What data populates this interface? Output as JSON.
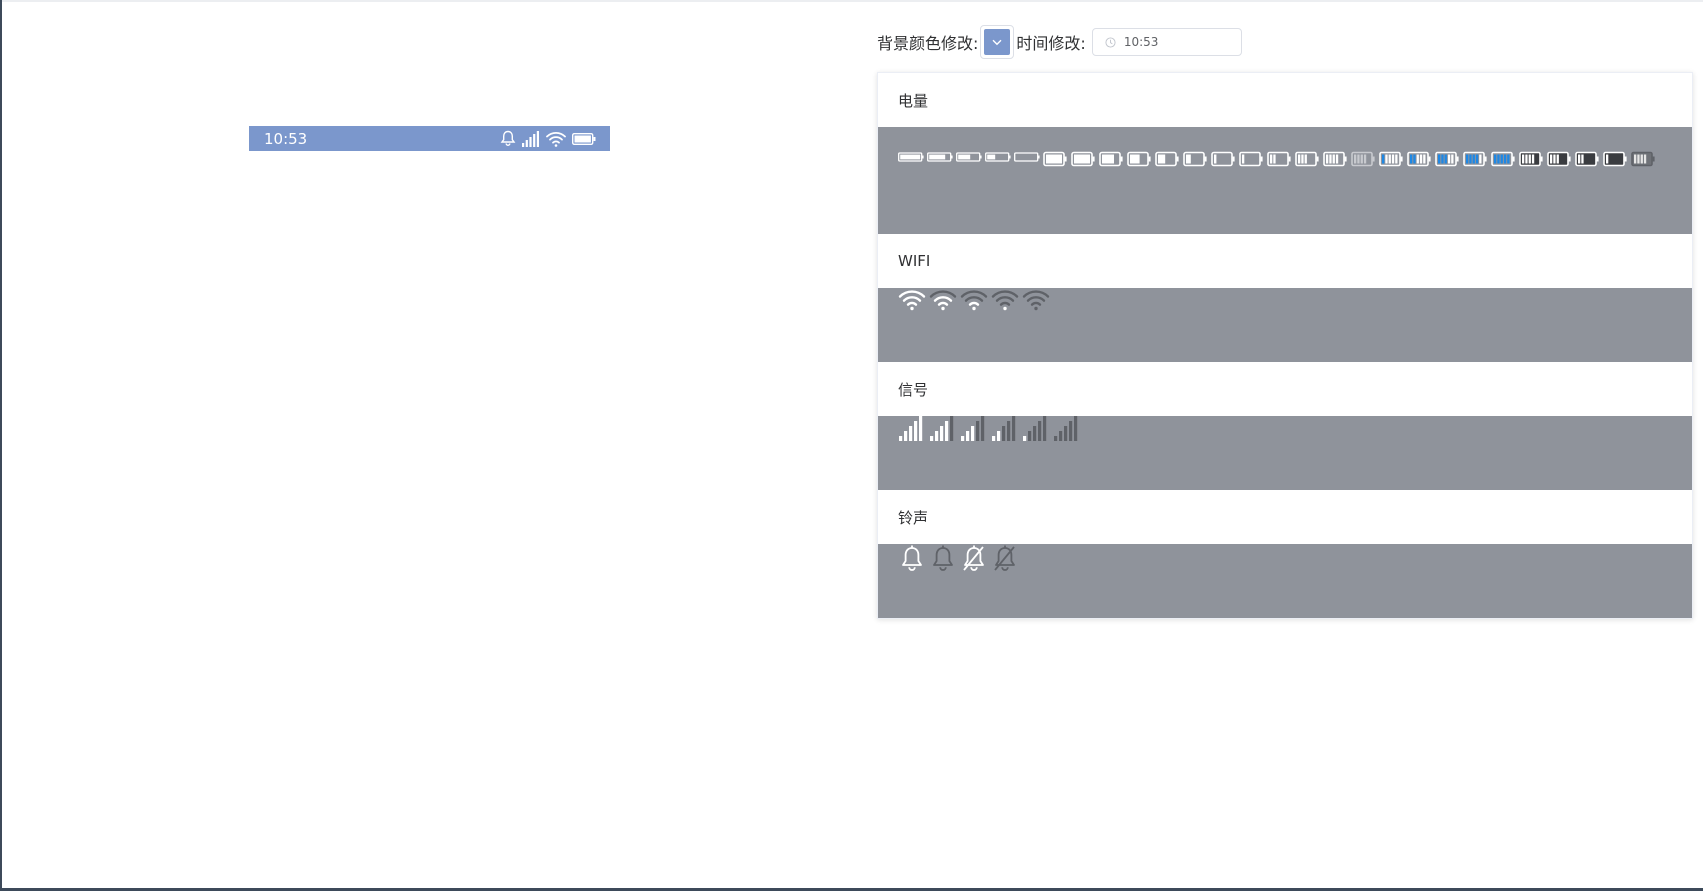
{
  "status_bar": {
    "time": "10:53",
    "background": "#7b97cc",
    "icons": [
      "bell-icon",
      "signal-icon",
      "wifi-icon",
      "battery-icon"
    ]
  },
  "toolbar": {
    "bg_color_label": "背景颜色修改:",
    "bg_color_value": "#7b97cc",
    "time_label": "时间修改:",
    "time_value": "10:53"
  },
  "sections": {
    "battery": {
      "title": "电量",
      "icons": [
        {
          "name": "battery-long-icon",
          "fill": 1.0,
          "color": "#ffffff",
          "long": true
        },
        {
          "name": "battery-long-icon",
          "fill": 0.8,
          "color": "#ffffff",
          "long": true
        },
        {
          "name": "battery-long-icon",
          "fill": 0.6,
          "color": "#ffffff",
          "long": true
        },
        {
          "name": "battery-long-icon",
          "fill": 0.4,
          "color": "#ffffff",
          "long": true
        },
        {
          "name": "battery-long-icon",
          "fill": 0.0,
          "color": "#ffffff",
          "long": true
        },
        {
          "name": "battery-icon",
          "fill": 1.0,
          "color": "#ffffff"
        },
        {
          "name": "battery-icon",
          "fill": 1.0,
          "color": "#ffffff"
        },
        {
          "name": "battery-icon",
          "fill": 0.75,
          "color": "#ffffff"
        },
        {
          "name": "battery-icon",
          "fill": 0.6,
          "color": "#ffffff"
        },
        {
          "name": "battery-icon",
          "fill": 0.45,
          "color": "#ffffff"
        },
        {
          "name": "battery-icon",
          "fill": 0.3,
          "color": "#ffffff"
        },
        {
          "name": "battery-icon",
          "fill": 0.15,
          "color": "#ffffff"
        },
        {
          "name": "battery-bars-icon",
          "bars": 1,
          "color": "#ffffff"
        },
        {
          "name": "battery-bars-icon",
          "bars": 2,
          "color": "#ffffff"
        },
        {
          "name": "battery-bars-icon",
          "bars": 3,
          "color": "#ffffff"
        },
        {
          "name": "battery-bars-icon",
          "bars": 4,
          "color": "#ffffff"
        },
        {
          "name": "battery-bars-icon",
          "bars": 4,
          "color": "#c8cacf"
        },
        {
          "name": "battery-bars-icon",
          "bars": 1,
          "color": "#ffffff",
          "accent": "#1e88e5"
        },
        {
          "name": "battery-bars-icon",
          "bars": 2,
          "color": "#ffffff",
          "accent": "#1e88e5"
        },
        {
          "name": "battery-bars-icon",
          "bars": 3,
          "color": "#ffffff",
          "accent": "#1e88e5"
        },
        {
          "name": "battery-bars-icon",
          "bars": 4,
          "color": "#ffffff",
          "accent": "#1e88e5"
        },
        {
          "name": "battery-bars-icon",
          "bars": 5,
          "color": "#ffffff",
          "accent": "#1e88e5"
        },
        {
          "name": "battery-bars-icon",
          "bars": 4,
          "color": "#ffffff",
          "dark": true
        },
        {
          "name": "battery-bars-icon",
          "bars": 3,
          "color": "#ffffff",
          "dark": true
        },
        {
          "name": "battery-bars-icon",
          "bars": 2,
          "color": "#ffffff",
          "dark": true
        },
        {
          "name": "battery-bars-icon",
          "bars": 1,
          "color": "#ffffff",
          "dark": true
        },
        {
          "name": "battery-bars-icon",
          "bars": 4,
          "color": "#5f6268",
          "dark": true
        }
      ]
    },
    "wifi": {
      "title": "WIFI",
      "icons": [
        {
          "name": "wifi-icon",
          "level": 4
        },
        {
          "name": "wifi-icon",
          "level": 3
        },
        {
          "name": "wifi-icon",
          "level": 2
        },
        {
          "name": "wifi-icon",
          "level": 1
        },
        {
          "name": "wifi-icon",
          "level": 0
        }
      ]
    },
    "signal": {
      "title": "信号",
      "icons": [
        {
          "name": "signal-icon",
          "level": 5
        },
        {
          "name": "signal-icon",
          "level": 4
        },
        {
          "name": "signal-icon",
          "level": 3
        },
        {
          "name": "signal-icon",
          "level": 2
        },
        {
          "name": "signal-icon",
          "level": 1
        },
        {
          "name": "signal-icon",
          "level": 0
        }
      ]
    },
    "ringtone": {
      "title": "铃声",
      "icons": [
        {
          "name": "bell-icon",
          "muted": false,
          "color": "#ffffff"
        },
        {
          "name": "bell-icon",
          "muted": false,
          "color": "#5f6268"
        },
        {
          "name": "bell-muted-icon",
          "muted": true,
          "color": "#ffffff"
        },
        {
          "name": "bell-muted-icon",
          "muted": true,
          "color": "#5f6268"
        }
      ]
    }
  },
  "colors": {
    "section_body_bg": "#8f939b",
    "dim_icon": "#5f6268",
    "accent_blue": "#1e88e5"
  }
}
